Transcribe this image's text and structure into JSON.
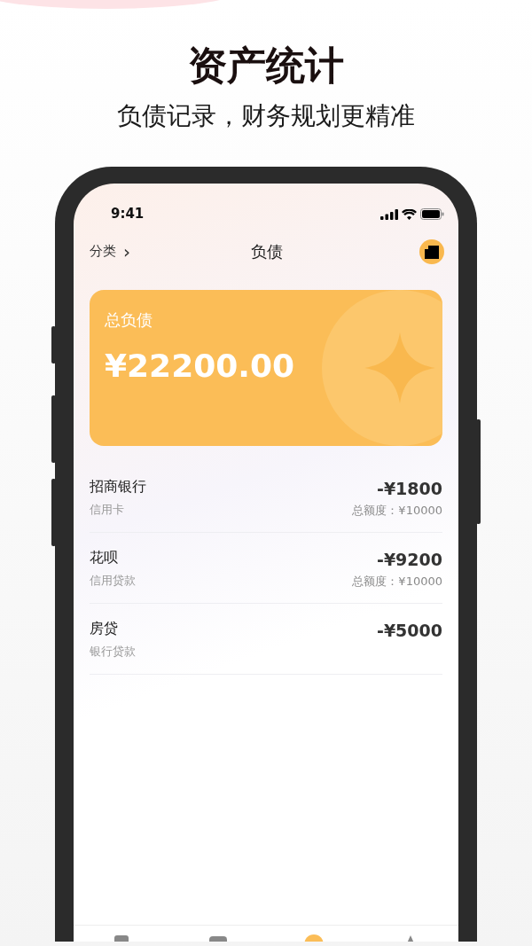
{
  "promo": {
    "title": "资产统计",
    "subtitle": "负债记录，财务规划更精准"
  },
  "status_bar": {
    "time": "9:41"
  },
  "nav": {
    "category": "分类",
    "chevron": "›",
    "title": "负债"
  },
  "summary": {
    "label": "总负债",
    "amount": "¥22200.00"
  },
  "debts": [
    {
      "name": "招商银行",
      "type": "信用卡",
      "amount": "-¥1800",
      "limit": "总额度：¥10000"
    },
    {
      "name": "花呗",
      "type": "信用贷款",
      "amount": "-¥9200",
      "limit": "总额度：¥10000"
    },
    {
      "name": "房贷",
      "type": "银行贷款",
      "amount": "-¥5000"
    }
  ],
  "tab_bar": [
    {
      "selected": false
    },
    {
      "selected": false
    },
    {
      "selected": true
    },
    {
      "selected": false
    }
  ]
}
